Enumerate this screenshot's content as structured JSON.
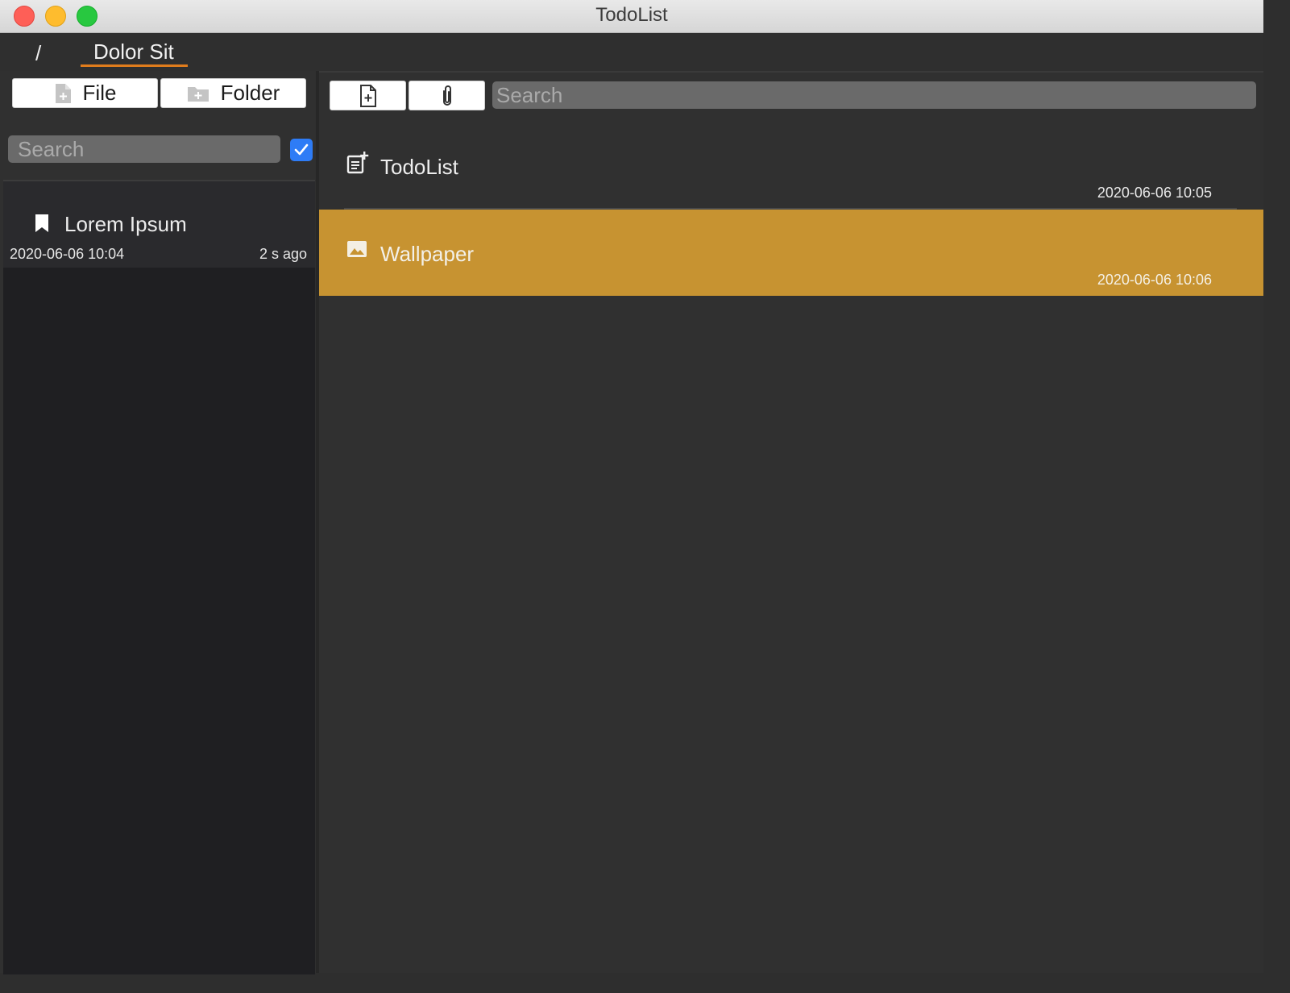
{
  "window": {
    "title": "TodoList"
  },
  "breadcrumb": {
    "root": "/",
    "current": "Dolor Sit"
  },
  "left": {
    "file_button": "File",
    "folder_button": "Folder",
    "search_placeholder": "Search",
    "checkbox_checked": true,
    "notes": [
      {
        "title": "Lorem Ipsum",
        "date": "2020-06-06 10:04",
        "ago": "2 s ago",
        "icon": "bookmark-icon"
      }
    ]
  },
  "right": {
    "new_file_icon": "new-file-icon",
    "attach_icon": "paperclip-icon",
    "search_placeholder": "Search",
    "items": [
      {
        "title": "TodoList",
        "date": "2020-06-06 10:05",
        "icon": "todo-add-icon",
        "selected": false
      },
      {
        "title": "Wallpaper",
        "date": "2020-06-06 10:06",
        "icon": "image-icon",
        "selected": true
      }
    ]
  },
  "colors": {
    "accent": "#e07c1c",
    "selected_row": "#c79331",
    "checkbox": "#2e7cf6"
  }
}
